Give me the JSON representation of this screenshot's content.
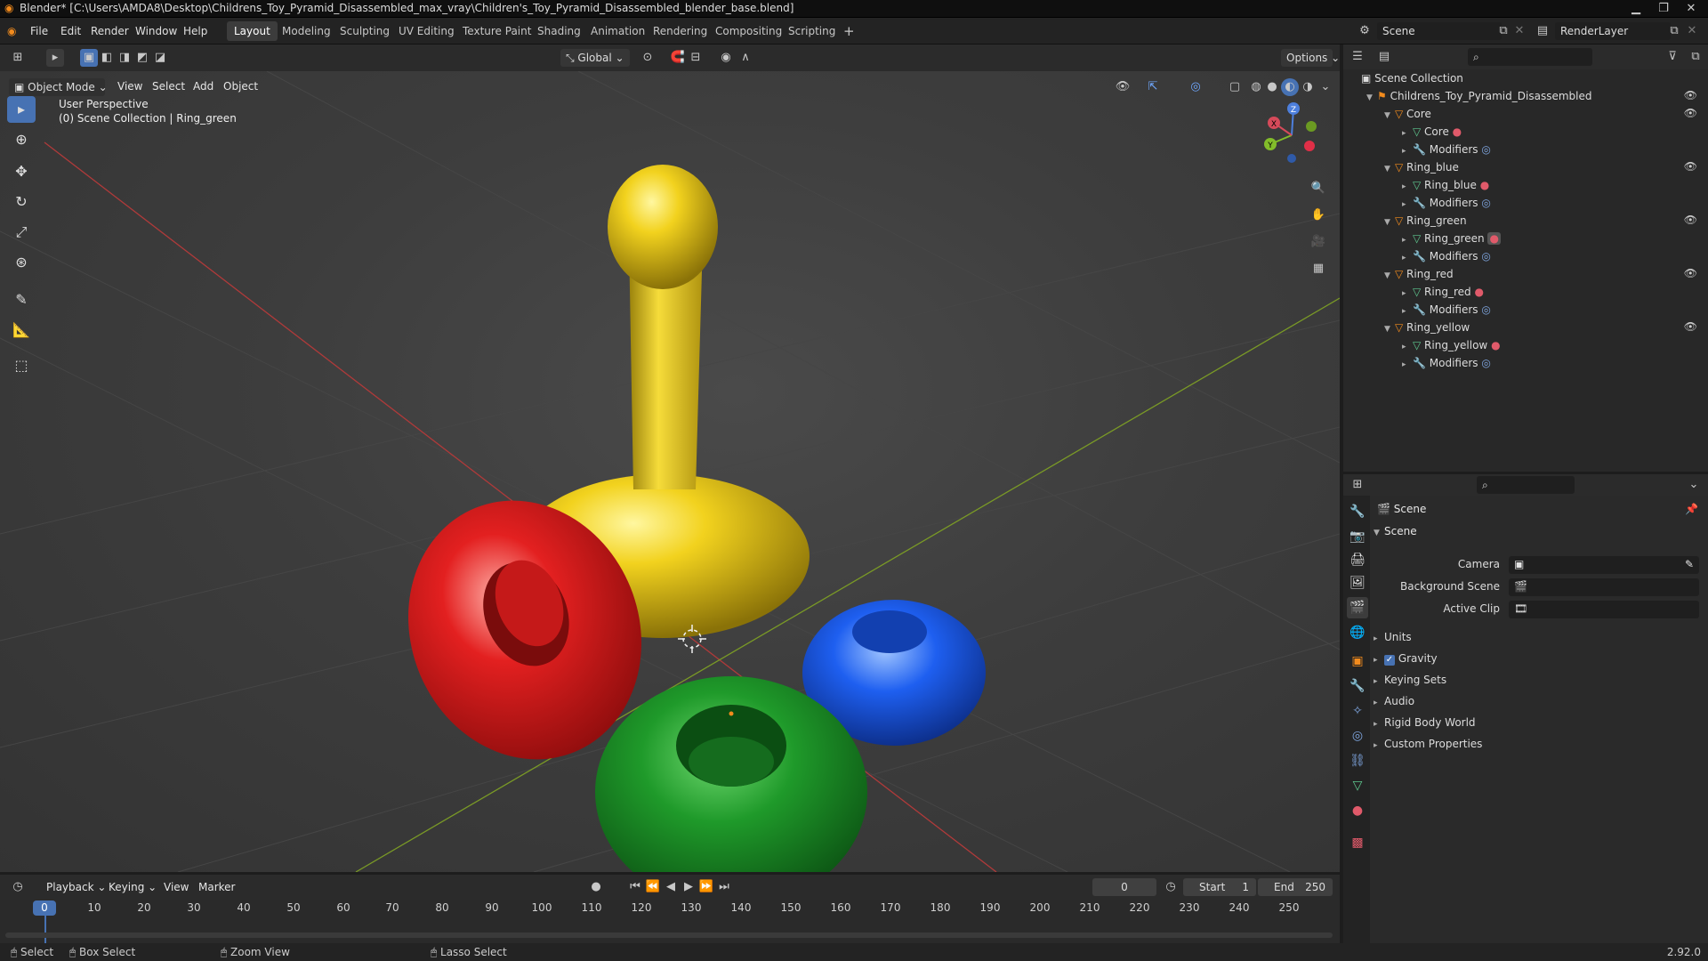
{
  "window": {
    "title": "Blender* [C:\\Users\\AMDA8\\Desktop\\Childrens_Toy_Pyramid_Disassembled_max_vray\\Children's_Toy_Pyramid_Disassembled_blender_base.blend]"
  },
  "menu": [
    "File",
    "Edit",
    "Render",
    "Window",
    "Help"
  ],
  "workspaces": [
    "Layout",
    "Modeling",
    "Sculpting",
    "UV Editing",
    "Texture Paint",
    "Shading",
    "Animation",
    "Rendering",
    "Compositing",
    "Scripting"
  ],
  "top_right": {
    "scene": "Scene",
    "view_layer": "RenderLayer"
  },
  "viewport_header": {
    "mode": "Object Mode",
    "menus": [
      "View",
      "Select",
      "Add",
      "Object"
    ],
    "orientation": "Global",
    "options": "Options"
  },
  "viewport": {
    "perspective": "User Perspective",
    "context": "(0) Scene Collection | Ring_green",
    "gizmo": {
      "x": "X",
      "y": "Y",
      "z": "Z"
    }
  },
  "colors": {
    "active_blue": "#4772b3",
    "yellow": "#f2d21e",
    "red": "#e32020",
    "green": "#1f9a2a",
    "blue": "#1e5ff0"
  },
  "outliner": {
    "root": "Scene Collection",
    "collection": "Childrens_Toy_Pyramid_Disassembled",
    "modifiers": "Modifiers",
    "objects": [
      "Core",
      "Ring_blue",
      "Ring_green",
      "Ring_red",
      "Ring_yellow"
    ]
  },
  "properties": {
    "header": "Scene",
    "section": "Scene",
    "fields": [
      {
        "label": "Camera",
        "value": ""
      },
      {
        "label": "Background Scene",
        "value": ""
      },
      {
        "label": "Active Clip",
        "value": ""
      }
    ],
    "subsections": [
      "Units",
      "Gravity",
      "Keying Sets",
      "Audio",
      "Rigid Body World",
      "Custom Properties"
    ]
  },
  "timeline": {
    "menus": [
      "Playback",
      "Keying",
      "View",
      "Marker"
    ],
    "current_frame": "0",
    "start_label": "Start",
    "start": "1",
    "end_label": "End",
    "end": "250",
    "ticks": [
      "0",
      "10",
      "20",
      "30",
      "40",
      "50",
      "60",
      "70",
      "80",
      "90",
      "100",
      "110",
      "120",
      "130",
      "140",
      "150",
      "160",
      "170",
      "180",
      "190",
      "200",
      "210",
      "220",
      "230",
      "240",
      "250"
    ]
  },
  "statusbar": {
    "select": "Select",
    "box_select": "Box Select",
    "zoom_view": "Zoom View",
    "lasso_select": "Lasso Select",
    "version": "2.92.0"
  }
}
